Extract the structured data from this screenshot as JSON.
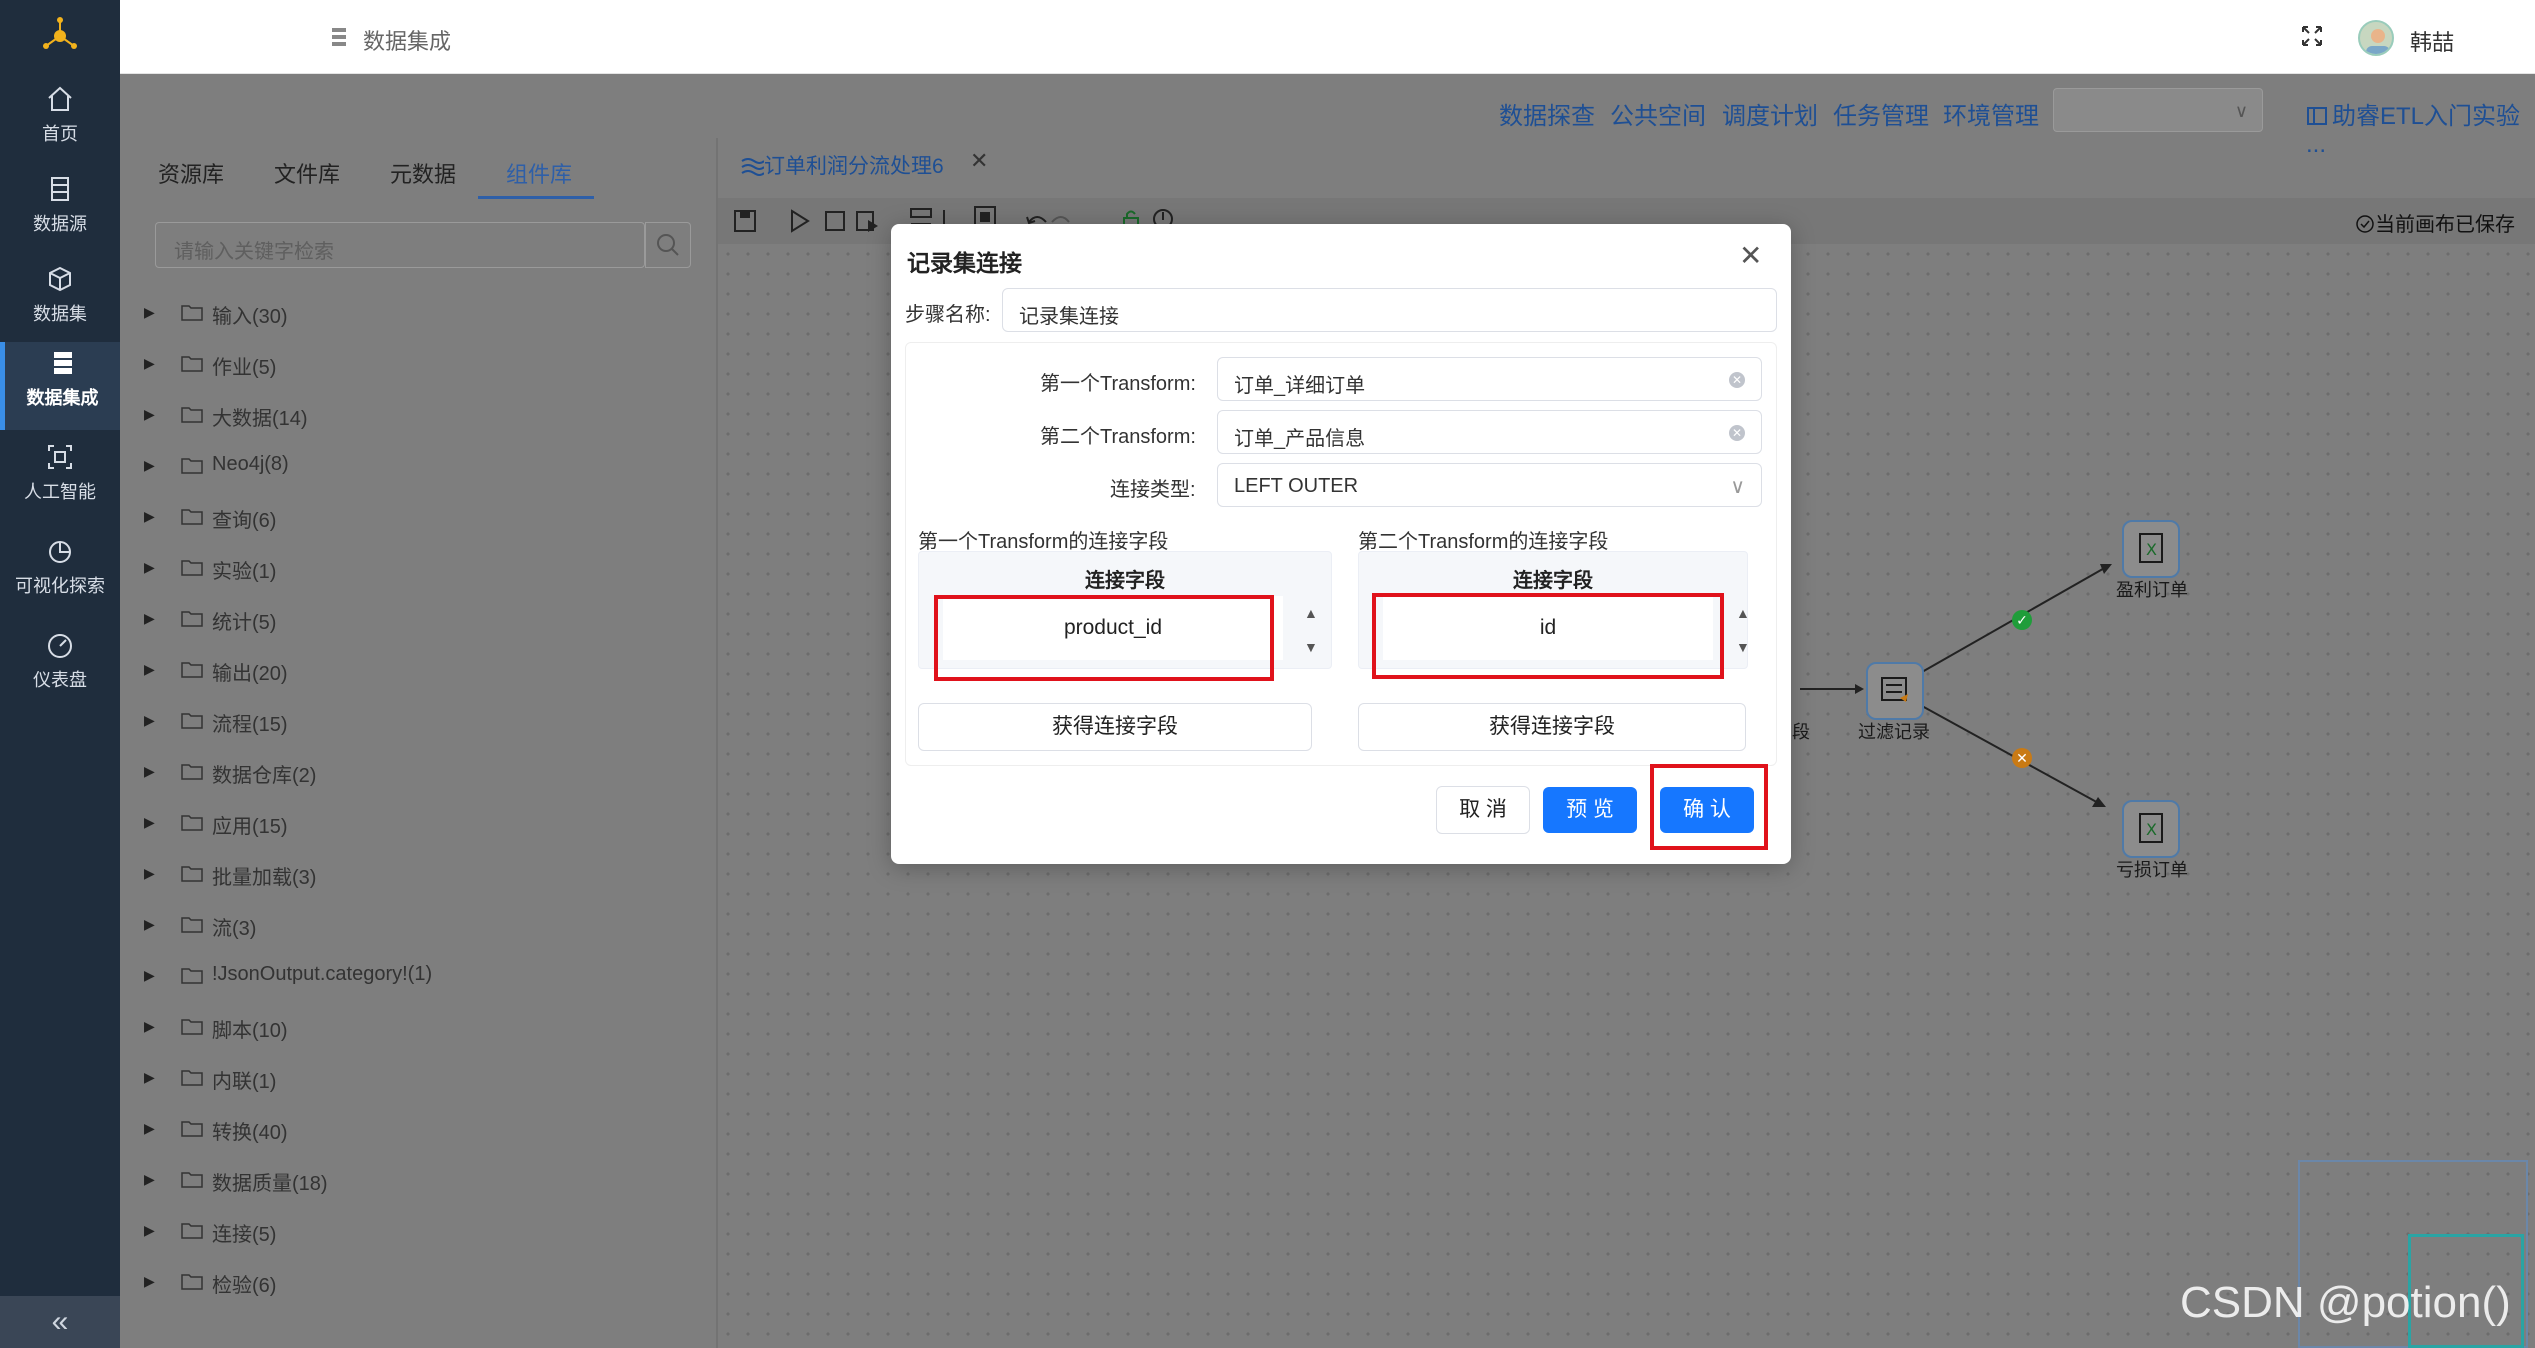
{
  "sidebar": {
    "items": [
      {
        "label": "首页",
        "icon": "home-icon"
      },
      {
        "label": "数据源",
        "icon": "database-icon"
      },
      {
        "label": "数据集",
        "icon": "cube-icon"
      },
      {
        "label": "数据集成",
        "icon": "server-icon",
        "active": true
      },
      {
        "label": "人工智能",
        "icon": "ai-scan-icon"
      },
      {
        "label": "可视化探索",
        "icon": "pie-chart-icon"
      },
      {
        "label": "仪表盘",
        "icon": "gauge-icon"
      }
    ],
    "collapse": "«"
  },
  "header": {
    "title": "数据集成",
    "user": "韩喆"
  },
  "topmenu": {
    "items": [
      "数据探查",
      "公共空间",
      "调度计划",
      "任务管理",
      "环境管理"
    ],
    "help": "助睿ETL入门实验 ..."
  },
  "left_panel": {
    "tabs": [
      "资源库",
      "文件库",
      "元数据",
      "组件库"
    ],
    "active_tab": "组件库",
    "search_placeholder": "请输入关键字检索",
    "tree": [
      "输入(30)",
      "作业(5)",
      "大数据(14)",
      "Neo4j(8)",
      "查询(6)",
      "实验(1)",
      "统计(5)",
      "输出(20)",
      "流程(15)",
      "数据仓库(2)",
      "应用(15)",
      "批量加载(3)",
      "流(3)",
      "!JsonOutput.category!(1)",
      "脚本(10)",
      "内联(1)",
      "转换(40)",
      "数据质量(18)",
      "连接(5)",
      "检验(6)"
    ]
  },
  "canvas": {
    "tab_title": "订单利润分流处理6",
    "saved_status": "当前画布已保存",
    "nodes": [
      "盈利订单",
      "过滤记录",
      "亏损订单",
      "段"
    ]
  },
  "modal": {
    "title": "记录集连接",
    "step_label": "步骤名称:",
    "step_value": "记录集连接",
    "first_label": "第一个Transform:",
    "first_value": "订单_详细订单",
    "second_label": "第二个Transform:",
    "second_value": "订单_产品信息",
    "join_label": "连接类型:",
    "join_value": "LEFT OUTER",
    "first_fields_title": "第一个Transform的连接字段",
    "second_fields_title": "第二个Transform的连接字段",
    "field_header": "连接字段",
    "first_field": "product_id",
    "second_field": "id",
    "get_fields_btn": "获得连接字段",
    "cancel": "取 消",
    "preview": "预 览",
    "confirm": "确 认"
  },
  "watermark": "CSDN @potion()"
}
